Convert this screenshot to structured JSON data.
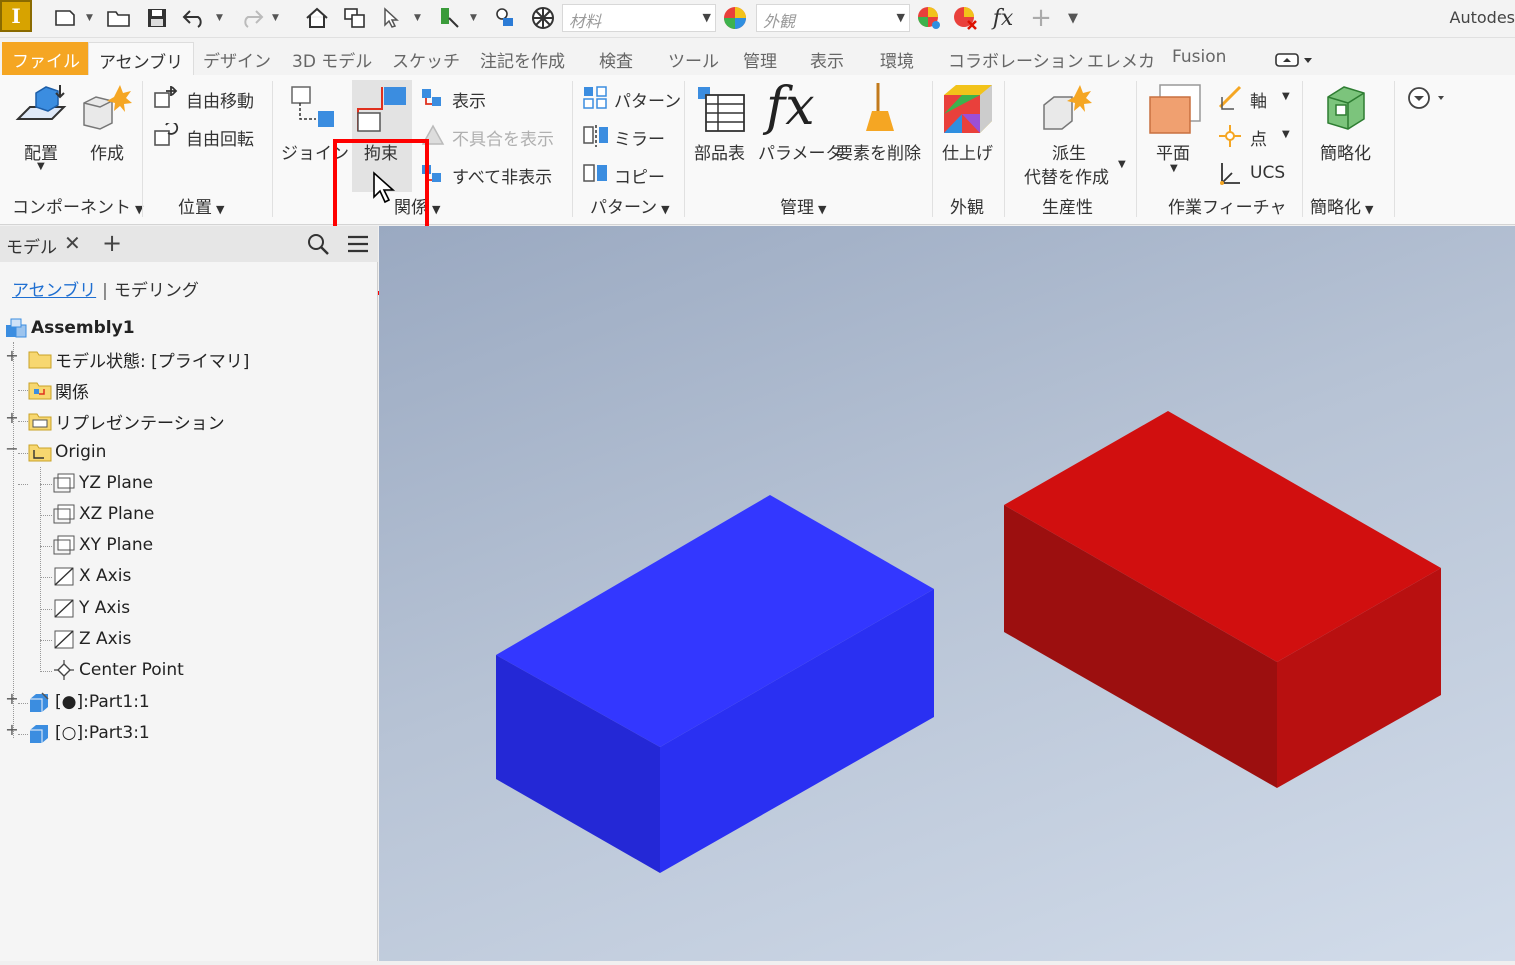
{
  "quick_access": {
    "app_icon": "inventor-logo-icon",
    "material_placeholder": "材料",
    "appearance_placeholder": "外観",
    "app_name": "Autodes"
  },
  "ribbon_tabs": [
    "ファイル",
    "アセンブリ",
    "デザイン",
    "3D モデル",
    "スケッチ",
    "注記を作成",
    "検査",
    "ツール",
    "管理",
    "表示",
    "環境",
    "コラボレーション",
    "エレメカ",
    "Fusion"
  ],
  "active_tab": "アセンブリ",
  "ribbon": {
    "component": {
      "place": "配置",
      "create": "作成",
      "group": "コンポーネント"
    },
    "position": {
      "free_move": "自由移動",
      "free_rotate": "自由回転",
      "group": "位置"
    },
    "relationships": {
      "joint": "ジョイント",
      "constrain": "拘束",
      "show": "表示",
      "show_sick": "不具合を表示",
      "hide_all": "すべて非表示",
      "group": "関係"
    },
    "pattern": {
      "pattern": "パターン",
      "mirror": "ミラー",
      "copy": "コピー",
      "group": "パターン"
    },
    "manage": {
      "bom": "部品表",
      "parameters": "パラメータ",
      "delete_face": "要素を削除",
      "group": "管理"
    },
    "appearance": {
      "finish": "仕上げ",
      "group": "外観"
    },
    "productivity": {
      "derive_line1": "派生",
      "derive_line2": "代替を作成",
      "group": "生産性"
    },
    "work_features": {
      "plane": "平面",
      "axis": "軸",
      "point": "点",
      "ucs": "UCS",
      "group": "作業フィーチャ"
    },
    "simplification": {
      "simplify": "簡略化",
      "group": "簡略化"
    }
  },
  "browser": {
    "title": "モデル",
    "subtab_assembly": "アセンブリ",
    "subtab_modeling": "モデリング",
    "tree": {
      "root": "Assembly1",
      "model_states": "モデル状態: [プライマリ]",
      "relationships": "関係",
      "representations": "リプレゼンテーション",
      "origin": "Origin",
      "yz_plane": "YZ Plane",
      "xz_plane": "XZ Plane",
      "xy_plane": "XY Plane",
      "x_axis": "X Axis",
      "y_axis": "Y Axis",
      "z_axis": "Z Axis",
      "center_point": "Center Point",
      "part1": "[●]:Part1:1",
      "part3": "[○]:Part3:1"
    }
  },
  "viewport": {
    "blue_box_color": "#2f3cff",
    "red_box_color": "#d10f0f"
  }
}
